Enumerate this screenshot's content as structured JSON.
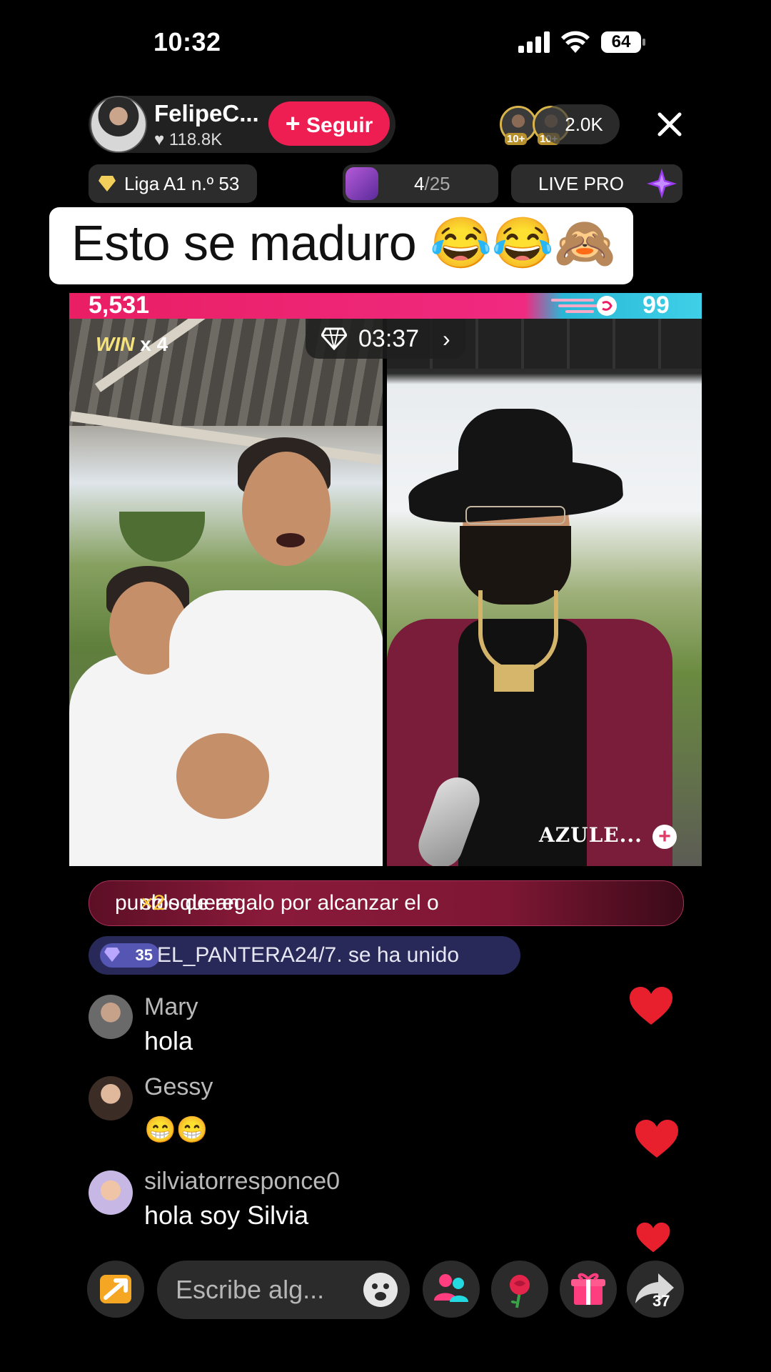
{
  "status_bar": {
    "time": "10:32",
    "battery": "64"
  },
  "host": {
    "name": "FelipeC...",
    "likes": "118.8K",
    "follow_label": "Seguir"
  },
  "viewers": {
    "badge_1": "10+",
    "badge_2": "10+",
    "count": "2.0K"
  },
  "chips": {
    "league": "Liga A1 n.º 53",
    "progress_current": "4",
    "progress_total": "/25",
    "live_pro": "LIVE PRO"
  },
  "caption": "Esto se maduro 😂😂🙈",
  "battle": {
    "score_left": "5,531",
    "score_right": "99",
    "win_label": "WIN",
    "win_multiplier": "x 4",
    "timer": "03:37",
    "opponent_name": "AZULE..."
  },
  "banner": {
    "before": "sbloquean ",
    "multiplier": "×2",
    "after": " puntos de regalo por alcanzar el o"
  },
  "join_notice": {
    "level": "35",
    "text": "EL_PANTERA24/7. se ha unido"
  },
  "comments": [
    {
      "user": "Mary",
      "text": "hola"
    },
    {
      "user": "Gessy",
      "text": "😁😁"
    },
    {
      "user": "silviatorresponce0",
      "text": "hola soy Silvia"
    }
  ],
  "bottom_bar": {
    "input_placeholder": "Escribe alg...",
    "share_count": "37"
  },
  "colors": {
    "accent": "#ee1d52",
    "battle_left": "#e91e63",
    "battle_right": "#3fd0e8",
    "heart": "#e8202e"
  },
  "icons": [
    "signal-icon",
    "wifi-icon",
    "battery-icon",
    "heart-icon",
    "close-icon",
    "diamond-icon",
    "star-icon",
    "emoji-icon",
    "people-icon",
    "rose-icon",
    "gift-icon",
    "share-icon"
  ]
}
